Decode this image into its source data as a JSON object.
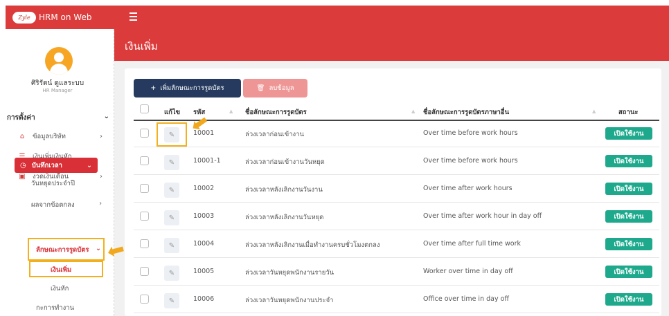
{
  "app": {
    "logo_text": "Zyle",
    "title": "HRM on Web"
  },
  "user": {
    "name": "ศิริรัตน์ ดูแลระบบ",
    "role": "HR Manager"
  },
  "sidebar": {
    "section_title": "การตั้งค่า",
    "items": [
      {
        "label": "ข้อมูลบริษัท",
        "icon": "home-icon"
      },
      {
        "label": "เงินเพิ่มเงินหัก",
        "icon": "list-icon"
      },
      {
        "label": "งวดเงินเดือน",
        "icon": "money-icon"
      }
    ],
    "active_item": {
      "label": "บันทึกเวลา",
      "icon": "clock-icon"
    },
    "sub_items": [
      "วันหยุดประจำปี",
      "ผลจากข้อตกลง",
      "ลักษณะการรูดบัตร",
      "เงินเพิ่ม",
      "เงินหัก",
      "กะการทำงาน"
    ]
  },
  "page": {
    "title": "เงินเพิ่ม"
  },
  "toolbar": {
    "add_label": "เพิ่มลักษณะการรูดบัตร",
    "delete_label": "ลบข้อมูล"
  },
  "table": {
    "headers": {
      "edit": "แก้ไข",
      "code": "รหัส",
      "name": "ชื่อลักษณะการรูดบัตร",
      "name_other": "ชื่อลักษณะการรูดบัตรภาษาอื่น",
      "status": "สถานะ"
    },
    "rows": [
      {
        "code": "10001",
        "name": "ล่วงเวลาก่อนเข้างาน",
        "name_other": "Over time before work hours",
        "status": "เปิดใช้งาน"
      },
      {
        "code": "10001-1",
        "name": "ล่วงเวลาก่อนเข้างานวันหยุด",
        "name_other": "Over time before work hours",
        "status": "เปิดใช้งาน"
      },
      {
        "code": "10002",
        "name": "ล่วงเวลาหลังเลิกงานวันงาน",
        "name_other": "Over time after work hours",
        "status": "เปิดใช้งาน"
      },
      {
        "code": "10003",
        "name": "ล่วงเวลาหลังเลิกงานวันหยุด",
        "name_other": "Over time after work hour in day off",
        "status": "เปิดใช้งาน"
      },
      {
        "code": "10004",
        "name": "ล่วงเวลาหลังเลิกงานเมื่อทำงานครบชั่วโมงตกลง",
        "name_other": "Over time after full time work",
        "status": "เปิดใช้งาน"
      },
      {
        "code": "10005",
        "name": "ล่วงเวลาวันหยุดพนักงานรายวัน",
        "name_other": "Worker over time in day off",
        "status": "เปิดใช้งาน"
      },
      {
        "code": "10006",
        "name": "ล่วงเวลาวันหยุดพนักงานประจำ",
        "name_other": "Office over time in day off",
        "status": "เปิดใช้งาน"
      }
    ]
  },
  "colors": {
    "primary_red": "#dc3b3b",
    "navy": "#253a5e",
    "green": "#1ea98d",
    "highlight": "#f2b01e"
  }
}
